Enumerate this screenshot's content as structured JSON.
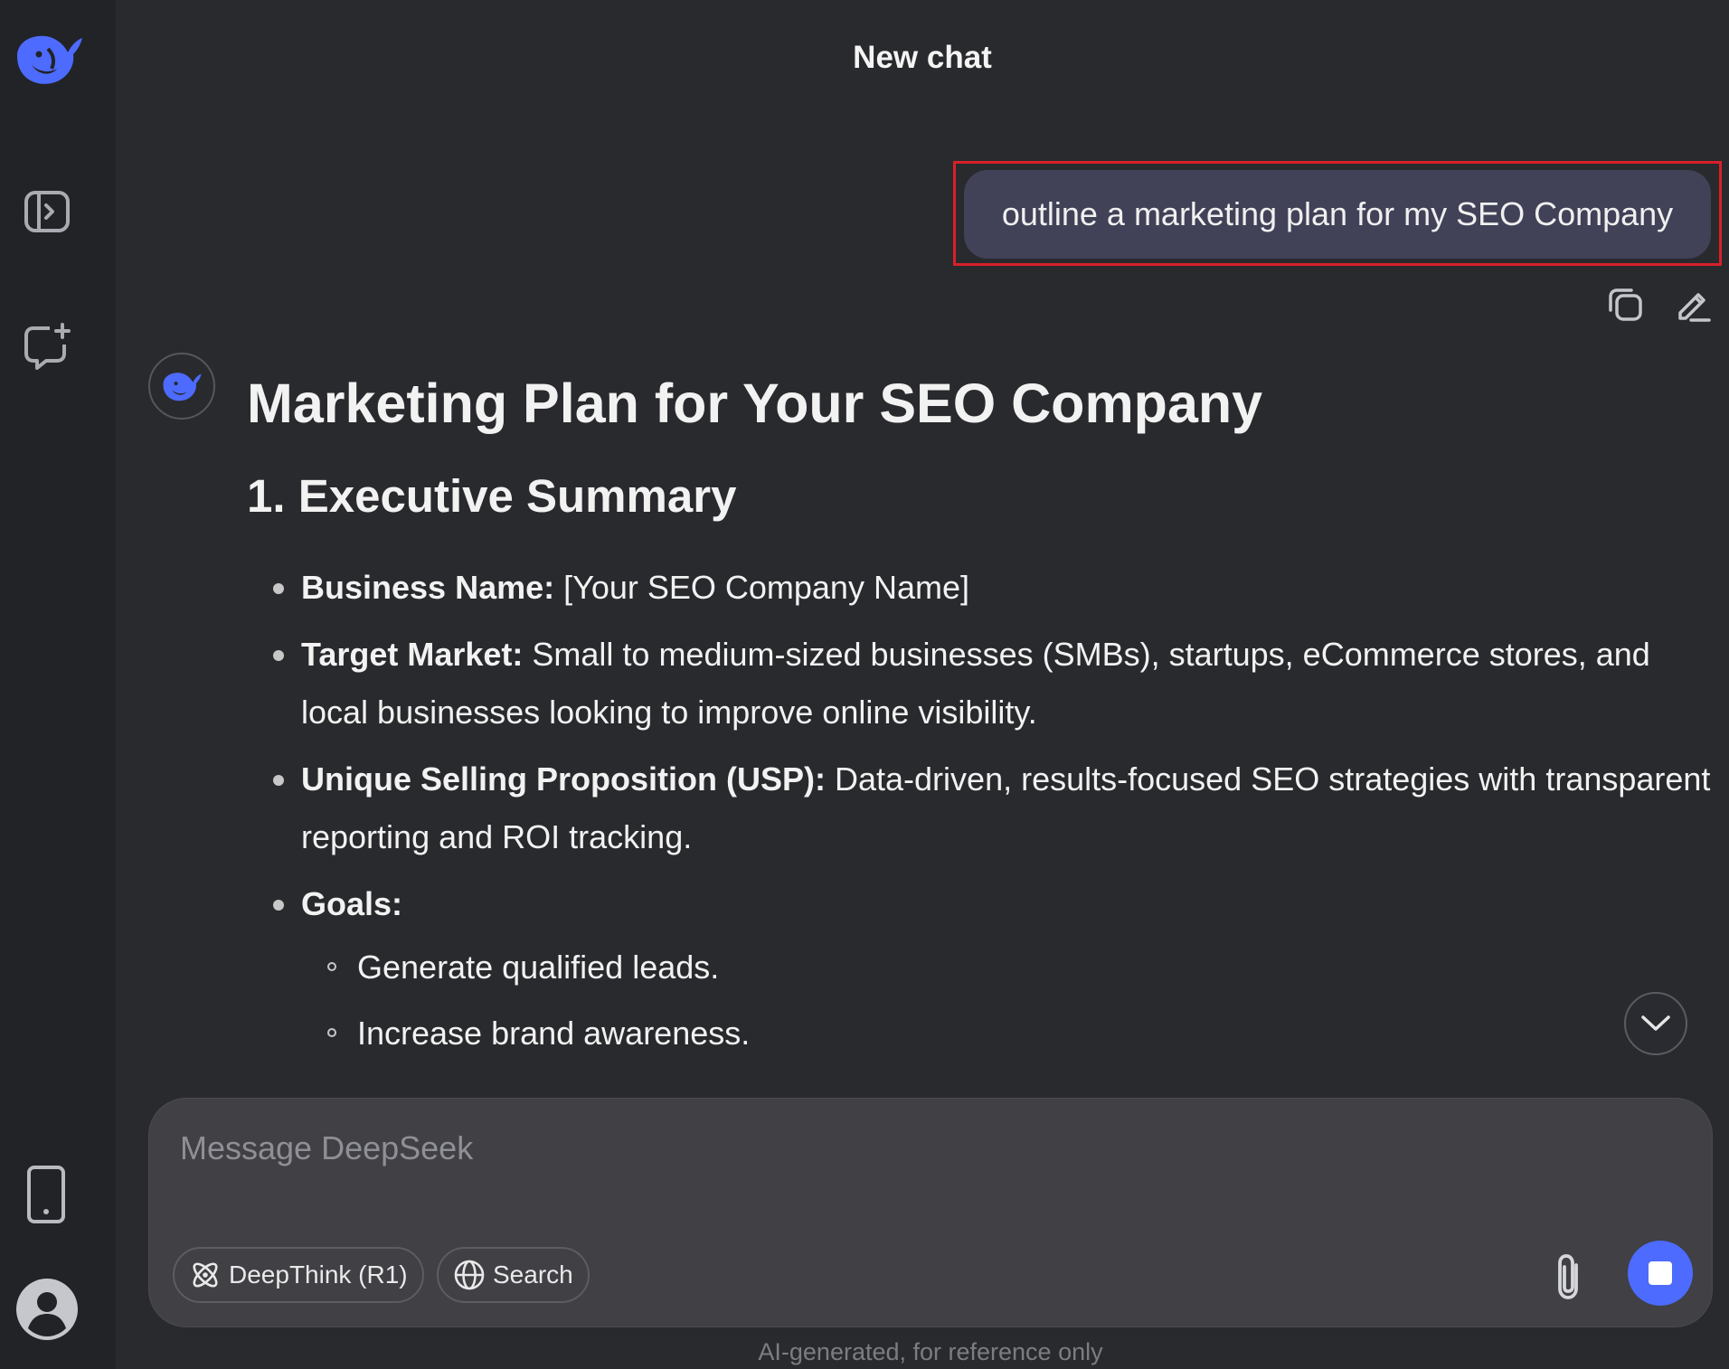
{
  "header": {
    "title": "New chat"
  },
  "sidebar": {
    "logo_icon": "deepseek-whale-icon",
    "toggle_icon": "sidebar-toggle-icon",
    "new_chat_icon": "new-chat-icon",
    "app_icon": "mobile-app-icon",
    "profile_icon": "user-profile-icon"
  },
  "user_message": {
    "text": "outline a marketing plan for my SEO Company",
    "actions": [
      "copy-icon",
      "edit-icon"
    ]
  },
  "answer": {
    "title": "Marketing Plan for Your SEO Company",
    "section_title": "1. Executive Summary",
    "items": [
      {
        "label": "Business Name:",
        "text": " [Your SEO Company Name]"
      },
      {
        "label": "Target Market:",
        "text": " Small to medium-sized businesses (SMBs), startups, eCommerce stores, and local businesses looking to improve online visibility."
      },
      {
        "label": "Unique Selling Proposition (USP):",
        "text": " Data-driven, results-focused SEO strategies with transparent reporting and ROI tracking."
      },
      {
        "label": "Goals:",
        "text": ""
      }
    ],
    "goals": [
      "Generate qualified leads.",
      "Increase brand awareness."
    ]
  },
  "composer": {
    "placeholder": "Message DeepSeek",
    "deepthink_label": "DeepThink (R1)",
    "search_label": "Search"
  },
  "footer": {
    "disclaimer": "AI-generated, for reference only"
  },
  "colors": {
    "accent": "#4d6bfe",
    "highlight_border": "#d8202a",
    "bubble": "#414158"
  }
}
